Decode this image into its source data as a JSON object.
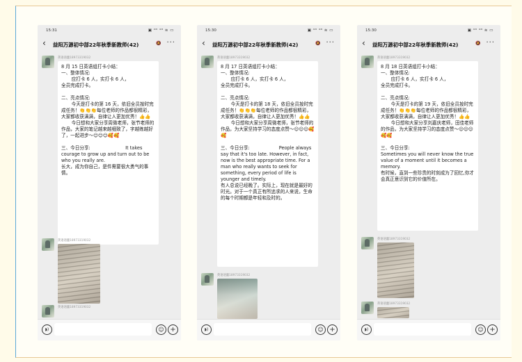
{
  "screens": [
    {
      "status_time": "15:31",
      "status_icons": "▣ ⁴ᴳ ⁴ᴳ ≋ ▭",
      "back_icon": "chevron-left-icon",
      "group_title": "益阳万源初中部22年秋季新教师(42)",
      "mute_icon": "mute-icon",
      "more_icon": "more-icon",
      "sender": "英语语蕾18973319032",
      "report": "8 月 15 日英语组打卡小结：\n一、整体情况:\n       应打卡 6 人，实打卡 6 人，\n全员完成打卡。\n\n二、亮点情况:\n       今天是打卡的第 16 天，依旧全员按时完成任务！👏👏👏每位老师的作品都很精彩，大家都收获满满，自律让人更加优秀！👍👍\n       今日想和大家分享周微老师，张节老师的作品，大家的笔记越来越细致了，字越练越好了，一起进步～😊😊😊🥰🥰\n\n三、今日分享:                        It takes courage to grow up and turn out to be who you really are.\n长大，成为你自己，是件需要很大勇气的事情。",
      "sender2": "英语语蕾18973319032",
      "sender3": "英语语蕾18973319032"
    },
    {
      "status_time": "15:30",
      "status_icons": "▣ ⁴ᴳ ⁴ᴳ ≋ ▭",
      "back_icon": "chevron-left-icon",
      "group_title": "益阳万源初中部22年秋季新教师(42)",
      "mute_icon": "mute-icon",
      "more_icon": "more-icon",
      "sender": "英语语蕾18973319032",
      "report": "8 月 17 日英语组打卡小结：\n一、整体情况:\n       应打卡 6 人，实打卡 6 人，\n全员完成打卡。\n\n二、亮点情况:\n       今天是打卡的第 18 天，依旧全员按时完成任务！👏👏👏每位老师的作品都很精彩，大家都收获满满，自律让人更加优秀！👍👍\n       今日想和大家分享周微老师，张节老师的作品，为大家坚持学习的态度点赞～😊😊😊🥰🥰\n\n三、今日分享:                    People always say that it's too late. However, in fact, now is the best appropriate time. For a man who really wants to seek for something, every period of life is younger and timely.\n有人总说已经晚了。实际上，现在就是最好的时光。对于一个真正有所追求的人来说，生命的每个时期都是年轻和及时的。",
      "sender2": "英语语蕾18973319032"
    },
    {
      "status_time": "15:30",
      "status_icons": "▣ ⁴ᴳ ⁴ᴳ ≋ ▭",
      "back_icon": "chevron-left-icon",
      "group_title": "益阳万源初中部22年秋季新教师(42)",
      "mute_icon": "mute-icon",
      "more_icon": "more-icon",
      "sender": "英语语蕾18973319032",
      "report": "8 月 18 日英语组打卡小结：\n一、整体情况:\n       应打卡 6 人，实打卡 6 人，\n全员完成打卡。\n\n二、亮点情况:\n       今天是打卡的第 19 天，依旧全员按时完成任务！👏👏👏每位老师的作品都很精彩，大家都收获满满，自律让人更加优秀！👍👍\n       今日想和大家分享刘嘉庆老师，田佳老师的作品，为大家坚持学习的态度点赞～😊😊😊🥰🥰\n\n三、今日分享:\nSometimes you will never know the true value of a moment until it becomes a memory.\n有时候，直到一些珍贵的时刻成为了回忆,你才会真正意识到它的价值所在。",
      "sender2": "英语语蕾18973319032",
      "sender3": "英语语蕾18973319032"
    }
  ],
  "input_bar": {
    "voice_icon": "voice-icon",
    "emoji_icon": "emoji-icon",
    "plus_icon": "plus-icon"
  }
}
